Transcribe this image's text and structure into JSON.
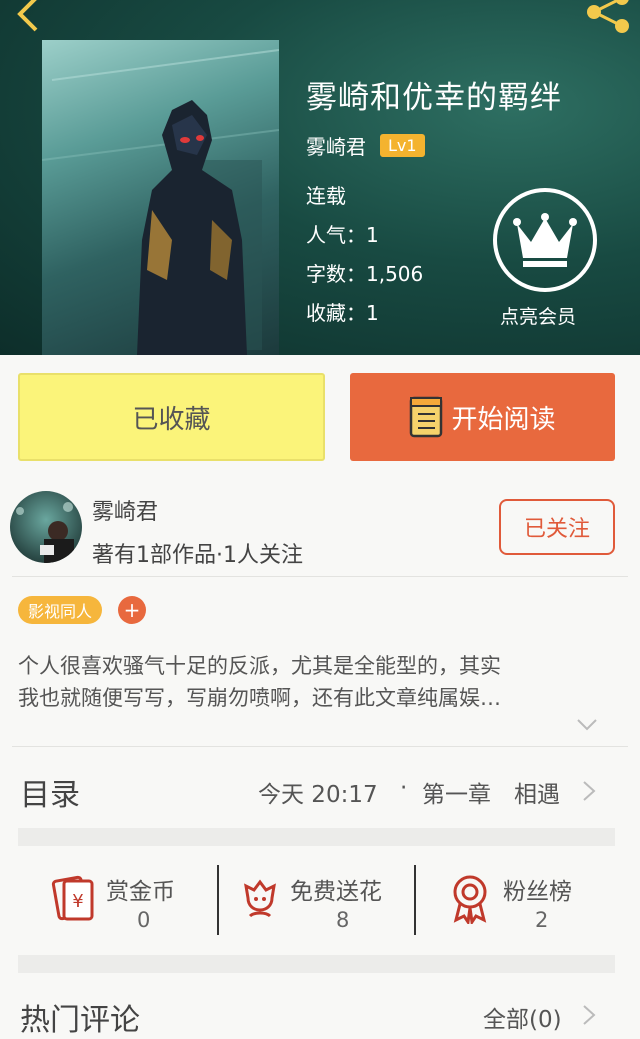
{
  "book": {
    "title": "雾崎和优幸的羁绊",
    "author": "雾崎君",
    "level": "Lv1",
    "status": "连载",
    "popularity": "人气：1",
    "word_count": "字数：1,506",
    "favorites": "收藏：1"
  },
  "vip": {
    "label": "点亮会员"
  },
  "actions": {
    "collected": "已收藏",
    "read": "开始阅读"
  },
  "author_card": {
    "name": "雾崎君",
    "stats": "著有1部作品·1人关注",
    "follow": "已关注"
  },
  "tags": [
    {
      "label": "影视同人"
    }
  ],
  "tag_add": "+",
  "description": {
    "line1": "个人很喜欢骚气十足的反派，尤其是全能型的，其实",
    "line2": "我也就随便写写，写崩勿喷啊，还有此文章纯属娱…"
  },
  "toc": {
    "label": "目录",
    "time": "今天 20:17",
    "separator": "·",
    "chapter": "第一章　相遇"
  },
  "stats": [
    {
      "label": "赏金币",
      "value": "0",
      "icon": "red-envelope-icon"
    },
    {
      "label": "免费送花",
      "value": "8",
      "icon": "flower-icon"
    },
    {
      "label": "粉丝榜",
      "value": "2",
      "icon": "medal-icon"
    }
  ],
  "comments": {
    "label": "热门评论",
    "all": "全部(0)"
  },
  "colors": {
    "accent": "#e8693e",
    "header": "#184a42",
    "collected": "#fbf47a",
    "tag": "#f6b63c"
  }
}
